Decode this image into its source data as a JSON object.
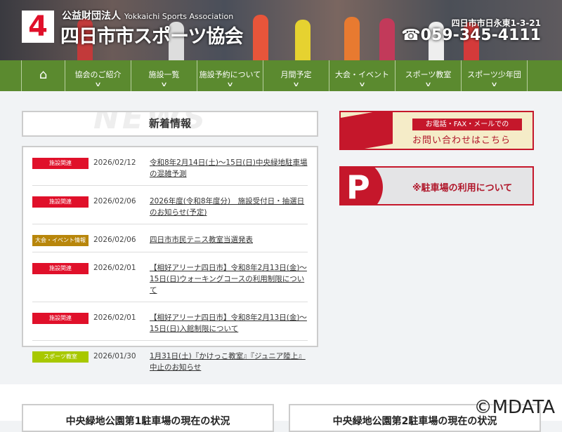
{
  "header": {
    "logo_mark": "4",
    "org_prefix": "公益財団法人",
    "org_english": "Yokkaichi Sports Association",
    "org_name": "四日市市スポーツ協会",
    "address": "四日市市日永東1-3-21",
    "phone": "☎059-345-4111"
  },
  "nav": [
    {
      "label": "協会のご紹介"
    },
    {
      "label": "施設一覧"
    },
    {
      "label": "施設予約について"
    },
    {
      "label": "月間予定"
    },
    {
      "label": "大会・イベント"
    },
    {
      "label": "スポーツ教室"
    },
    {
      "label": "スポーツ少年団"
    }
  ],
  "news": {
    "title": "新着情報",
    "watermark": "NEWS",
    "items": [
      {
        "category": "施設関連",
        "color": "#e0102a",
        "date": "2026/02/12",
        "title": "令和8年2月14日(土)～15日(日)中央緑地駐車場の混雑予測"
      },
      {
        "category": "施設関連",
        "color": "#e0102a",
        "date": "2026/02/06",
        "title": "2026年度(令和8年度分)　施設受付日・抽選日のお知らせ(予定)"
      },
      {
        "category": "大会・イベント情報",
        "color": "#b8860b",
        "date": "2026/02/06",
        "title": "四日市市民テニス教室当選発表"
      },
      {
        "category": "施設関連",
        "color": "#e0102a",
        "date": "2026/02/01",
        "title": "【相好アリーナ四日市】令和8年2月13日(金)～15日(日)ウォーキングコースの利用制限について"
      },
      {
        "category": "施設関連",
        "color": "#e0102a",
        "date": "2026/02/01",
        "title": "【相好アリーナ四日市】令和8年2月13日(金)～15日(日)入館制限について"
      },
      {
        "category": "スポーツ教室",
        "color": "#a8c800",
        "date": "2026/01/30",
        "title": "1月31日(土)『かけっこ教室』『ジュニア陸上』中止のお知らせ"
      }
    ]
  },
  "banners": {
    "contact_line1": "お電話・FAX・メールでの",
    "contact_line2": "お問い合わせはこちら",
    "parking_icon": "P",
    "parking": "※駐車場の利用について"
  },
  "parking_status": {
    "lot1": "中央緑地公園第1駐車場の現在の状況",
    "lot2": "中央緑地公園第2駐車場の現在の状況"
  },
  "watermark": "©MDATA"
}
